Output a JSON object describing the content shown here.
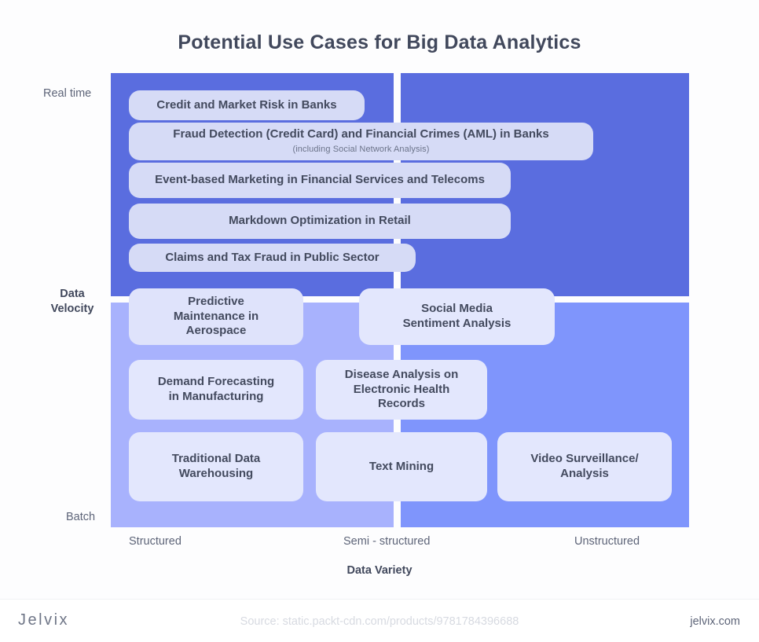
{
  "title": "Potential Use Cases for Big Data Analytics",
  "chart_data": {
    "type": "scatter",
    "title": "Potential Use Cases for Big Data Analytics",
    "xlabel": "Data Variety",
    "ylabel": "Data Velocity",
    "x_ticks": [
      "Structured",
      "Semi - structured",
      "Unstructured"
    ],
    "y_ticks": [
      "Real time",
      "Batch"
    ],
    "grid": false,
    "legend": null,
    "quadrants": [
      {
        "name": "top-left",
        "x_band": "Structured",
        "y_band": "Real time",
        "color": "#5a6ddf"
      },
      {
        "name": "top-right",
        "x_band": "Semi - structured / Unstructured",
        "y_band": "Real time",
        "color": "#5a6ddf"
      },
      {
        "name": "bottom-left",
        "x_band": "Structured",
        "y_band": "Batch",
        "color": "#a8b2fd"
      },
      {
        "name": "bottom-right",
        "x_band": "Semi - structured / Unstructured",
        "y_band": "Batch",
        "color": "#7f95fc"
      }
    ],
    "items": [
      {
        "label": "Credit and Market Risk in Banks",
        "sub": "",
        "velocity": "Real time",
        "variety": "Structured"
      },
      {
        "label": "Fraud Detection (Credit Card) and Financial Crimes (AML) in Banks",
        "sub": "(including Social Network Analysis)",
        "velocity": "Real time",
        "variety": "Structured to Semi - structured"
      },
      {
        "label": "Event-based Marketing in Financial Services and Telecoms",
        "sub": "",
        "velocity": "Real time",
        "variety": "Structured to Semi - structured"
      },
      {
        "label": "Markdown Optimization in Retail",
        "sub": "",
        "velocity": "Real time",
        "variety": "Structured to Semi - structured"
      },
      {
        "label": "Claims and Tax Fraud in Public Sector",
        "sub": "",
        "velocity": "Real time",
        "variety": "Structured"
      },
      {
        "label": "Predictive Maintenance in Aerospace",
        "sub": "",
        "velocity": "Real time to Batch",
        "variety": "Structured"
      },
      {
        "label": "Social Media Sentiment Analysis",
        "sub": "",
        "velocity": "Real time to Batch",
        "variety": "Semi - structured"
      },
      {
        "label": "Demand Forecasting in Manufacturing",
        "sub": "",
        "velocity": "Batch",
        "variety": "Structured"
      },
      {
        "label": "Disease Analysis on Electronic Health Records",
        "sub": "",
        "velocity": "Batch",
        "variety": "Structured to Semi - structured"
      },
      {
        "label": "Traditional Data Warehousing",
        "sub": "",
        "velocity": "Batch",
        "variety": "Structured"
      },
      {
        "label": "Text Mining",
        "sub": "",
        "velocity": "Batch",
        "variety": "Semi - structured"
      },
      {
        "label": "Video Surveillance/ Analysis",
        "sub": "",
        "velocity": "Batch",
        "variety": "Unstructured"
      }
    ]
  },
  "axes": {
    "y": {
      "name": "Data\nVelocity",
      "name_line1": "Data",
      "name_line2": "Velocity",
      "top_tick": "Real time",
      "bottom_tick": "Batch"
    },
    "x": {
      "name": "Data Variety",
      "tick_1": "Structured",
      "tick_2": "Semi - structured",
      "tick_3": "Unstructured"
    }
  },
  "nodes": {
    "credit_market_risk": "Credit and Market Risk in Banks",
    "fraud_detection": "Fraud Detection (Credit Card) and Financial Crimes (AML) in Banks",
    "fraud_detection_sub": "(including Social Network Analysis)",
    "event_marketing": "Event-based Marketing in Financial Services and Telecoms",
    "markdown_optimization": "Markdown Optimization in Retail",
    "claims_tax_fraud": "Claims and Tax Fraud in Public Sector",
    "predictive_maintenance_l1": "Predictive",
    "predictive_maintenance_l2": "Maintenance in",
    "predictive_maintenance_l3": "Aerospace",
    "social_media_l1": "Social Media",
    "social_media_l2": "Sentiment Analysis",
    "demand_forecasting_l1": "Demand Forecasting",
    "demand_forecasting_l2": "in Manufacturing",
    "disease_analysis_l1": "Disease Analysis on",
    "disease_analysis_l2": "Electronic Health",
    "disease_analysis_l3": "Records",
    "traditional_dw_l1": "Traditional Data",
    "traditional_dw_l2": "Warehousing",
    "text_mining": "Text Mining",
    "video_surveillance_l1": "Video Surveillance/",
    "video_surveillance_l2": "Analysis"
  },
  "footer": {
    "logo": "Jelvix",
    "source": "Source: static.packt-cdn.com/products/9781784396688",
    "site": "jelvix.com"
  },
  "colors": {
    "quadrant_top": "#5a6ddf",
    "quadrant_bottom_left": "#a8b2fd",
    "quadrant_bottom_right": "#7f95fc",
    "node_fill": "#d6dbf6",
    "text_dark": "#434a5e"
  }
}
